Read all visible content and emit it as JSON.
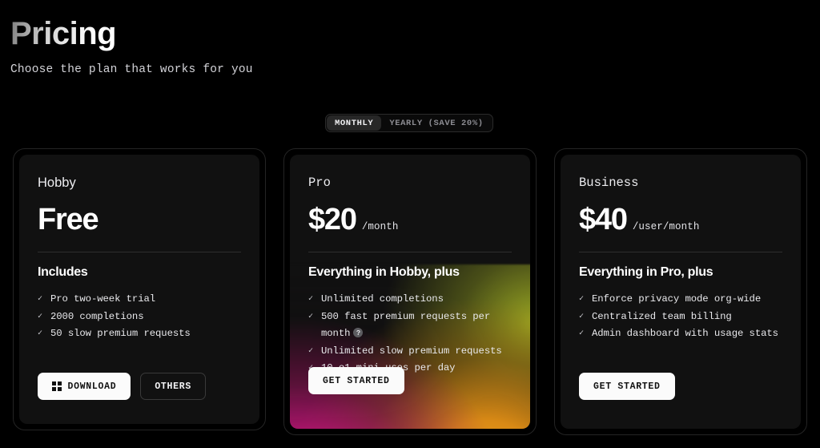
{
  "header": {
    "title": "Pricing",
    "subtitle": "Choose the plan that works for you"
  },
  "billing_toggle": {
    "monthly_label": "MONTHLY",
    "yearly_label": "YEARLY (SAVE 20%)",
    "selected": "MONTHLY"
  },
  "plans": [
    {
      "name": "Hobby",
      "price": "Free",
      "period": "",
      "features_title": "Includes",
      "features": [
        "Pro two-week trial",
        "2000 completions",
        "50 slow premium requests"
      ],
      "buttons": [
        {
          "label": "DOWNLOAD",
          "style": "light",
          "icon": "windows-icon"
        },
        {
          "label": "OTHERS",
          "style": "dark",
          "icon": ""
        }
      ]
    },
    {
      "name": "Pro",
      "price": "$20",
      "period": "/month",
      "features_title": "Everything in Hobby, plus",
      "features": [
        "Unlimited completions",
        "500 fast premium requests per month",
        "Unlimited slow premium requests",
        "10 o1-mini uses per day"
      ],
      "help_badge": "?",
      "buttons": [
        {
          "label": "GET STARTED",
          "style": "light",
          "icon": ""
        }
      ]
    },
    {
      "name": "Business",
      "price": "$40",
      "period": "/user/month",
      "features_title": "Everything in Pro, plus",
      "features": [
        "Enforce privacy mode org-wide",
        "Centralized team billing",
        "Admin dashboard with usage stats"
      ],
      "buttons": [
        {
          "label": "GET STARTED",
          "style": "light",
          "icon": ""
        }
      ]
    }
  ],
  "check_glyph": "✓",
  "colors": {
    "background": "#000000",
    "card_surface": "#111111",
    "card_border": "#242424",
    "divider": "#2e2e2e",
    "text_primary": "#ffffff",
    "text_secondary": "#d3d3d8",
    "toggle_active_bg": "#272727",
    "pro_gradient_pink": "#e01a86",
    "pro_gradient_orange": "#f2a51d",
    "pro_gradient_green": "#9aa823",
    "button_light_bg": "#fbfbfb"
  }
}
